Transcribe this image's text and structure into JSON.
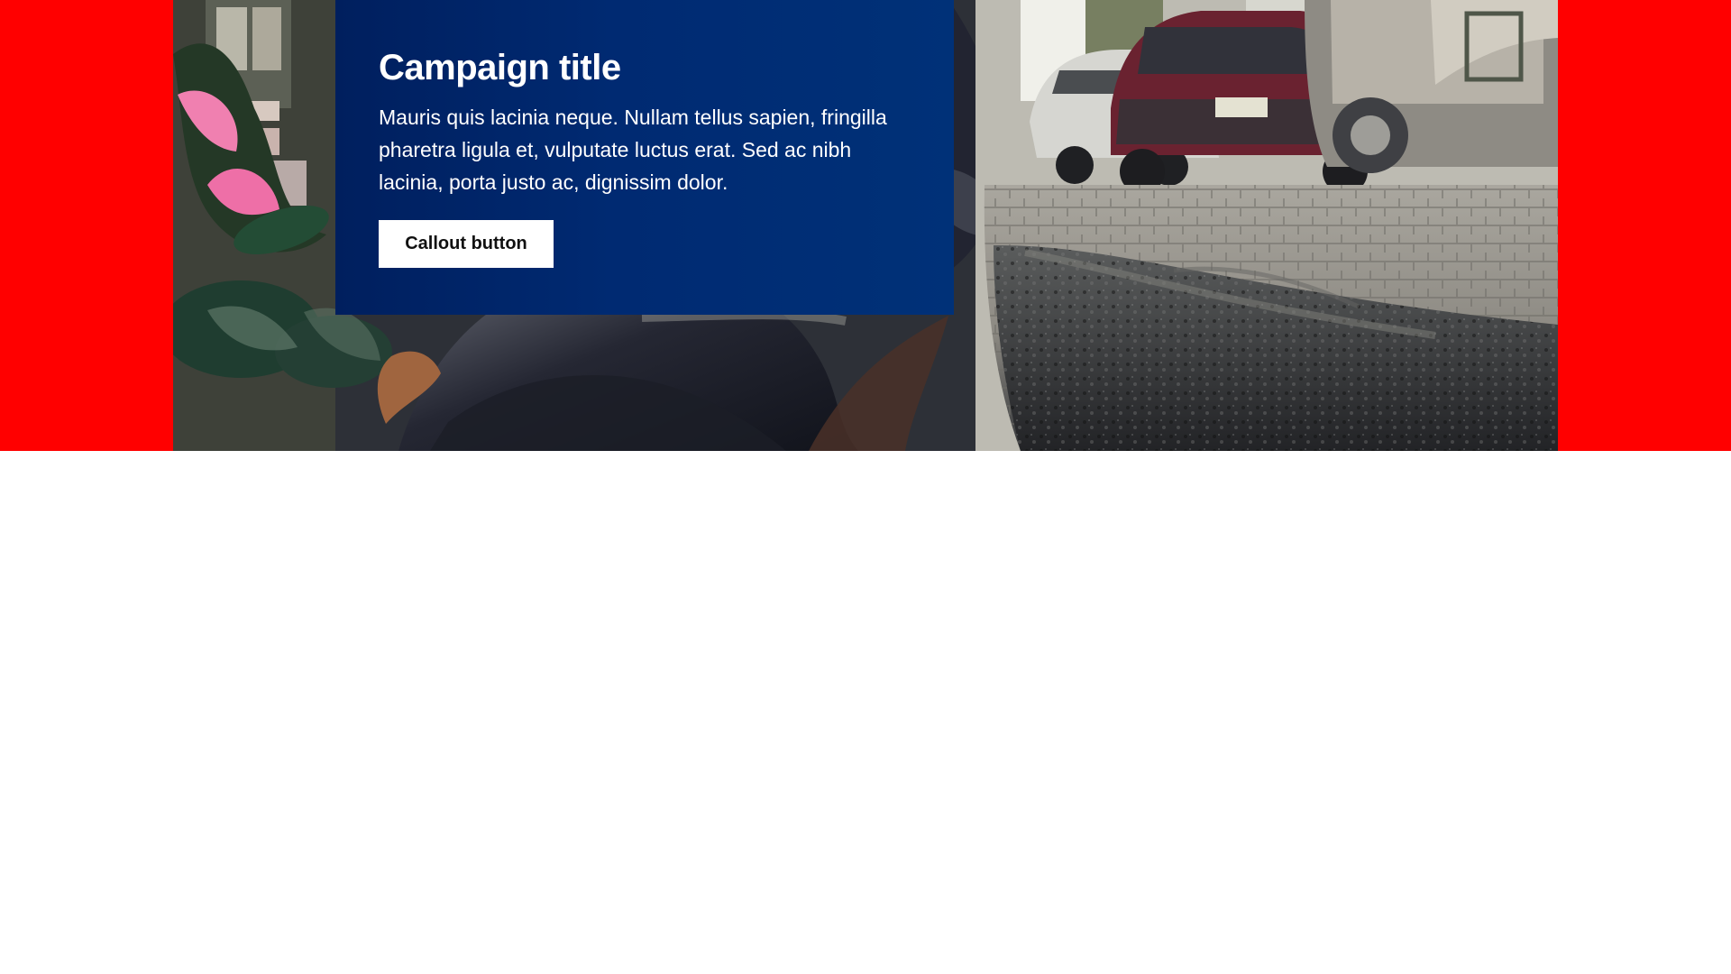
{
  "campaign": {
    "title": "Campaign title",
    "body": "Mauris quis lacinia neque. Nullam tellus sapien, fringilla pharetra ligula et, vulputate luctus erat. Sed ac nibh lacinia, porta justo ac, dignissim dolor.",
    "button_label": "Callout button"
  },
  "colors": {
    "frame": "#ff0000",
    "card_start": "#001f5e",
    "card_end": "#003178",
    "button_background": "#ffffff",
    "button_text": "#111111"
  }
}
